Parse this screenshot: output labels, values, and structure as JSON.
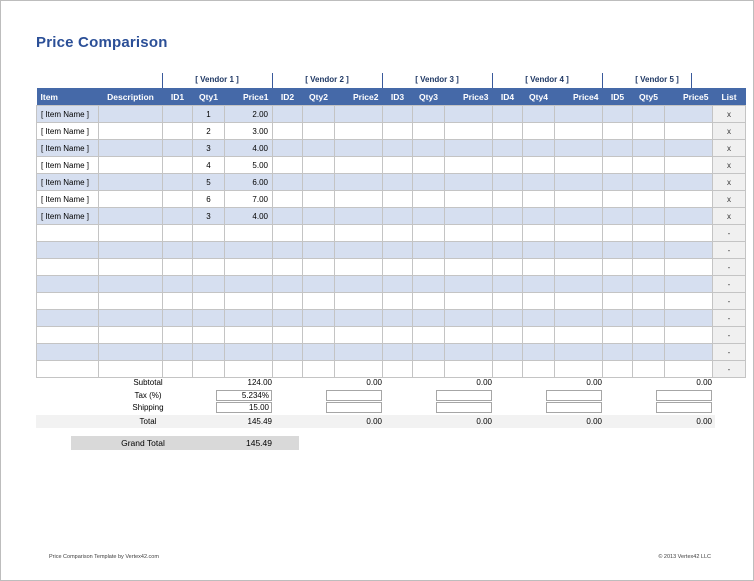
{
  "document": {
    "title": "Price Comparison"
  },
  "vendor_band": {
    "labels": [
      "[ Vendor 1 ]",
      "[ Vendor 2 ]",
      "[ Vendor 3 ]",
      "[ Vendor 4 ]",
      "[ Vendor 5 ]"
    ]
  },
  "table": {
    "columns": [
      "Item",
      "Description",
      "ID1",
      "Qty1",
      "Price1",
      "ID2",
      "Qty2",
      "Price2",
      "ID3",
      "Qty3",
      "Price3",
      "ID4",
      "Qty4",
      "Price4",
      "ID5",
      "Qty5",
      "Price5",
      "List"
    ],
    "rows": [
      {
        "item": "[ Item Name ]",
        "description": "",
        "id1": "",
        "qty1": "1",
        "price1": "2.00",
        "id2": "",
        "qty2": "",
        "price2": "",
        "id3": "",
        "qty3": "",
        "price3": "",
        "id4": "",
        "qty4": "",
        "price4": "",
        "id5": "",
        "qty5": "",
        "price5": "",
        "list": "x"
      },
      {
        "item": "[ Item Name ]",
        "description": "",
        "id1": "",
        "qty1": "2",
        "price1": "3.00",
        "id2": "",
        "qty2": "",
        "price2": "",
        "id3": "",
        "qty3": "",
        "price3": "",
        "id4": "",
        "qty4": "",
        "price4": "",
        "id5": "",
        "qty5": "",
        "price5": "",
        "list": "x"
      },
      {
        "item": "[ Item Name ]",
        "description": "",
        "id1": "",
        "qty1": "3",
        "price1": "4.00",
        "id2": "",
        "qty2": "",
        "price2": "",
        "id3": "",
        "qty3": "",
        "price3": "",
        "id4": "",
        "qty4": "",
        "price4": "",
        "id5": "",
        "qty5": "",
        "price5": "",
        "list": "x"
      },
      {
        "item": "[ Item Name ]",
        "description": "",
        "id1": "",
        "qty1": "4",
        "price1": "5.00",
        "id2": "",
        "qty2": "",
        "price2": "",
        "id3": "",
        "qty3": "",
        "price3": "",
        "id4": "",
        "qty4": "",
        "price4": "",
        "id5": "",
        "qty5": "",
        "price5": "",
        "list": "x"
      },
      {
        "item": "[ Item Name ]",
        "description": "",
        "id1": "",
        "qty1": "5",
        "price1": "6.00",
        "id2": "",
        "qty2": "",
        "price2": "",
        "id3": "",
        "qty3": "",
        "price3": "",
        "id4": "",
        "qty4": "",
        "price4": "",
        "id5": "",
        "qty5": "",
        "price5": "",
        "list": "x"
      },
      {
        "item": "[ Item Name ]",
        "description": "",
        "id1": "",
        "qty1": "6",
        "price1": "7.00",
        "id2": "",
        "qty2": "",
        "price2": "",
        "id3": "",
        "qty3": "",
        "price3": "",
        "id4": "",
        "qty4": "",
        "price4": "",
        "id5": "",
        "qty5": "",
        "price5": "",
        "list": "x"
      },
      {
        "item": "[ Item Name ]",
        "description": "",
        "id1": "",
        "qty1": "3",
        "price1": "4.00",
        "id2": "",
        "qty2": "",
        "price2": "",
        "id3": "",
        "qty3": "",
        "price3": "",
        "id4": "",
        "qty4": "",
        "price4": "",
        "id5": "",
        "qty5": "",
        "price5": "",
        "list": "x"
      },
      {
        "item": "",
        "description": "",
        "id1": "",
        "qty1": "",
        "price1": "",
        "id2": "",
        "qty2": "",
        "price2": "",
        "id3": "",
        "qty3": "",
        "price3": "",
        "id4": "",
        "qty4": "",
        "price4": "",
        "id5": "",
        "qty5": "",
        "price5": "",
        "list": "-"
      },
      {
        "item": "",
        "description": "",
        "id1": "",
        "qty1": "",
        "price1": "",
        "id2": "",
        "qty2": "",
        "price2": "",
        "id3": "",
        "qty3": "",
        "price3": "",
        "id4": "",
        "qty4": "",
        "price4": "",
        "id5": "",
        "qty5": "",
        "price5": "",
        "list": "-"
      },
      {
        "item": "",
        "description": "",
        "id1": "",
        "qty1": "",
        "price1": "",
        "id2": "",
        "qty2": "",
        "price2": "",
        "id3": "",
        "qty3": "",
        "price3": "",
        "id4": "",
        "qty4": "",
        "price4": "",
        "id5": "",
        "qty5": "",
        "price5": "",
        "list": "-"
      },
      {
        "item": "",
        "description": "",
        "id1": "",
        "qty1": "",
        "price1": "",
        "id2": "",
        "qty2": "",
        "price2": "",
        "id3": "",
        "qty3": "",
        "price3": "",
        "id4": "",
        "qty4": "",
        "price4": "",
        "id5": "",
        "qty5": "",
        "price5": "",
        "list": "-"
      },
      {
        "item": "",
        "description": "",
        "id1": "",
        "qty1": "",
        "price1": "",
        "id2": "",
        "qty2": "",
        "price2": "",
        "id3": "",
        "qty3": "",
        "price3": "",
        "id4": "",
        "qty4": "",
        "price4": "",
        "id5": "",
        "qty5": "",
        "price5": "",
        "list": "-"
      },
      {
        "item": "",
        "description": "",
        "id1": "",
        "qty1": "",
        "price1": "",
        "id2": "",
        "qty2": "",
        "price2": "",
        "id3": "",
        "qty3": "",
        "price3": "",
        "id4": "",
        "qty4": "",
        "price4": "",
        "id5": "",
        "qty5": "",
        "price5": "",
        "list": "-"
      },
      {
        "item": "",
        "description": "",
        "id1": "",
        "qty1": "",
        "price1": "",
        "id2": "",
        "qty2": "",
        "price2": "",
        "id3": "",
        "qty3": "",
        "price3": "",
        "id4": "",
        "qty4": "",
        "price4": "",
        "id5": "",
        "qty5": "",
        "price5": "",
        "list": "-"
      },
      {
        "item": "",
        "description": "",
        "id1": "",
        "qty1": "",
        "price1": "",
        "id2": "",
        "qty2": "",
        "price2": "",
        "id3": "",
        "qty3": "",
        "price3": "",
        "id4": "",
        "qty4": "",
        "price4": "",
        "id5": "",
        "qty5": "",
        "price5": "",
        "list": "-"
      },
      {
        "item": "",
        "description": "",
        "id1": "",
        "qty1": "",
        "price1": "",
        "id2": "",
        "qty2": "",
        "price2": "",
        "id3": "",
        "qty3": "",
        "price3": "",
        "id4": "",
        "qty4": "",
        "price4": "",
        "id5": "",
        "qty5": "",
        "price5": "",
        "list": "-"
      }
    ]
  },
  "totals": {
    "labels": {
      "subtotal": "Subtotal",
      "tax": "Tax (%)",
      "shipping": "Shipping",
      "total": "Total",
      "grand_total": "Grand Total"
    },
    "vendors": [
      {
        "subtotal": "124.00",
        "tax": "5.234%",
        "shipping": "15.00",
        "total": "145.49"
      },
      {
        "subtotal": "0.00",
        "tax": "",
        "shipping": "",
        "total": "0.00"
      },
      {
        "subtotal": "0.00",
        "tax": "",
        "shipping": "",
        "total": "0.00"
      },
      {
        "subtotal": "0.00",
        "tax": "",
        "shipping": "",
        "total": "0.00"
      },
      {
        "subtotal": "0.00",
        "tax": "",
        "shipping": "",
        "total": "0.00"
      }
    ],
    "grand_total_value": "145.49"
  },
  "footer": {
    "left": "Price Comparison Template by Vertex42.com",
    "right": "© 2013 Vertex42 LLC"
  },
  "colors": {
    "header_blue": "#4569a8",
    "title_blue": "#2b4f97",
    "row_alt": "#d6dff0",
    "total_bar": "#f2f2f2",
    "grand_bar": "#d9d9d9",
    "list_col": "#f0f0f0"
  }
}
